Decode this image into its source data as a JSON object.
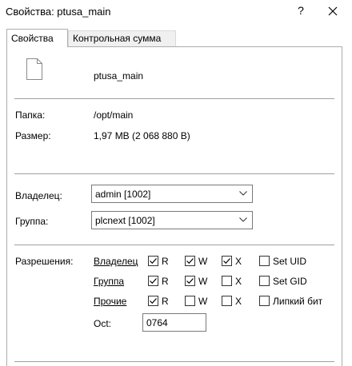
{
  "window": {
    "title": "Свойства: ptusa_main",
    "help_label": "?"
  },
  "tabs": [
    {
      "label": "Свойства",
      "active": true
    },
    {
      "label": "Контрольная сумма",
      "active": false
    }
  ],
  "file": {
    "icon": "file-icon",
    "name": "ptusa_main"
  },
  "info": {
    "folder_label": "Папка:",
    "folder_value": "/opt/main",
    "size_label": "Размер:",
    "size_value": "1,97 MB (2 068 880 B)"
  },
  "owner": {
    "label": "Владелец:",
    "value": "admin [1002]"
  },
  "group": {
    "label": "Группа:",
    "value": "plcnext [1002]"
  },
  "permissions": {
    "label": "Разрешения:",
    "rows": [
      {
        "label": "Владелец",
        "r": true,
        "w": true,
        "x": true,
        "extra_label": "Set UID",
        "extra": false
      },
      {
        "label": "Группа",
        "r": true,
        "w": true,
        "x": false,
        "extra_label": "Set GID",
        "extra": false
      },
      {
        "label": "Прочие",
        "r": true,
        "w": false,
        "x": false,
        "extra_label": "Липкий бит",
        "extra": false
      }
    ],
    "r_label": "R",
    "w_label": "W",
    "x_label": "X",
    "octal_label": "Oct:",
    "octal_value": "0764"
  }
}
